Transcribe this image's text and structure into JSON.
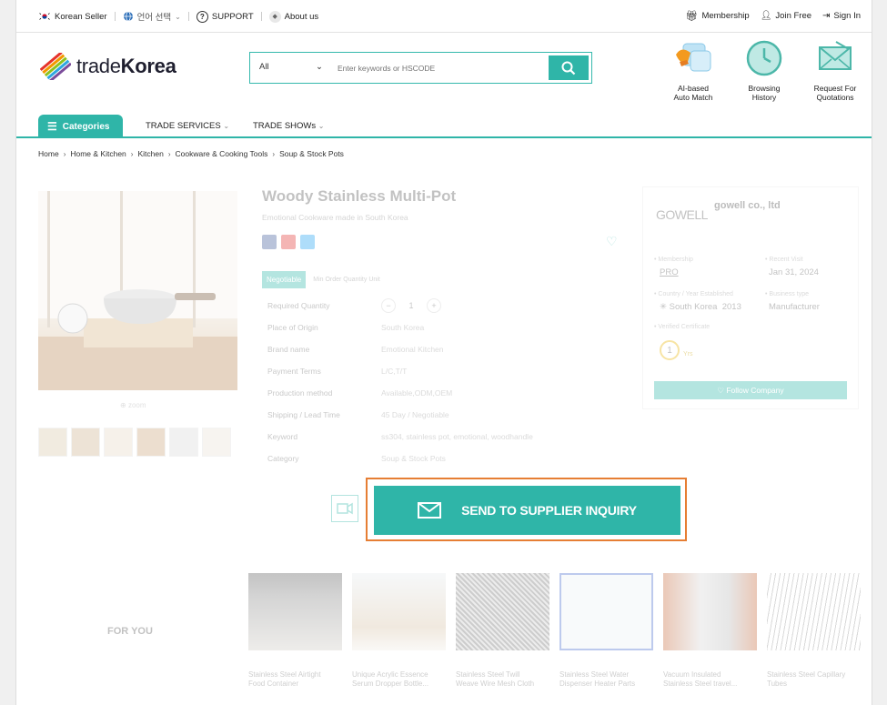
{
  "topbar": {
    "korean_seller": "Korean Seller",
    "language": "언어 선택",
    "support": "SUPPORT",
    "about": "About us",
    "membership": "Membership",
    "join": "Join Free",
    "signin": "Sign In"
  },
  "header": {
    "logo_light": "trade",
    "logo_bold": "Korea",
    "search_category": "All",
    "search_placeholder": "Enter keywords or HSCODE",
    "icons": [
      {
        "label1": "AI-based",
        "label2": "Auto Match"
      },
      {
        "label1": "Browsing",
        "label2": "History"
      },
      {
        "label1": "Request For",
        "label2": "Quotations"
      }
    ]
  },
  "nav": {
    "categories": "Categories",
    "trade_services": "TRADE SERVICES",
    "trade_shows": "TRADE SHOWs"
  },
  "breadcrumb": [
    "Home",
    "Home & Kitchen",
    "Kitchen",
    "Cookware & Cooking Tools",
    "Soup & Stock Pots"
  ],
  "product": {
    "zoom": "zoom",
    "title": "Woody Stainless Multi-Pot",
    "subtitle": "Emotional Cookware made in South Korea",
    "price_tag": "Negotiable",
    "moq": "Min Order Quantity Unit",
    "quantity": "1",
    "specs": [
      {
        "k": "Required Quantity",
        "v": ""
      },
      {
        "k": "Place of Origin",
        "v": "South Korea"
      },
      {
        "k": "Brand name",
        "v": "Emotional Kitchen"
      },
      {
        "k": "Payment Terms",
        "v": "L/C,T/T"
      },
      {
        "k": "Production method",
        "v": "Available,ODM,OEM"
      },
      {
        "k": "Shipping / Lead Time",
        "v": "45 Day / Negotiable"
      },
      {
        "k": "Keyword",
        "v": "ss304, stainless pot, emotional, woodhandle"
      },
      {
        "k": "Category",
        "v": "Soup & Stock Pots"
      }
    ]
  },
  "supplier": {
    "logo": "GOWELL",
    "name": "gowell co., ltd",
    "membership_label": "• Membership",
    "membership": "PRO",
    "recent_label": "• Recent Visit",
    "recent": "Jan 31, 2024",
    "country_label": "• Country / Year Established",
    "country": "South Korea",
    "year": "2013",
    "business_label": "• Business type",
    "business": "Manufacturer",
    "cert_label": "• Verified Certificate",
    "years": "1",
    "yrs": "Yrs",
    "follow": "Follow Company"
  },
  "inquiry": {
    "label": "SEND TO SUPPLIER INQUIRY"
  },
  "foryou": {
    "title": "FOR YOU",
    "items": [
      {
        "line1": "Stainless Steel Airtight",
        "line2": "Food Container"
      },
      {
        "line1": "Unique Acrylic Essence",
        "line2": "Serum Dropper Bottle..."
      },
      {
        "line1": "Stainless Steel Twill",
        "line2": "Weave Wire Mesh Cloth"
      },
      {
        "line1": "Stainless Steel Water",
        "line2": "Dispenser Heater Parts"
      },
      {
        "line1": "Vacuum Insulated",
        "line2": "Stainless Steel travel..."
      },
      {
        "line1": "Stainless Steel Capillary",
        "line2": "Tubes"
      }
    ]
  },
  "colors": {
    "accent": "#2fb5a8",
    "highlight": "#e67e34"
  }
}
